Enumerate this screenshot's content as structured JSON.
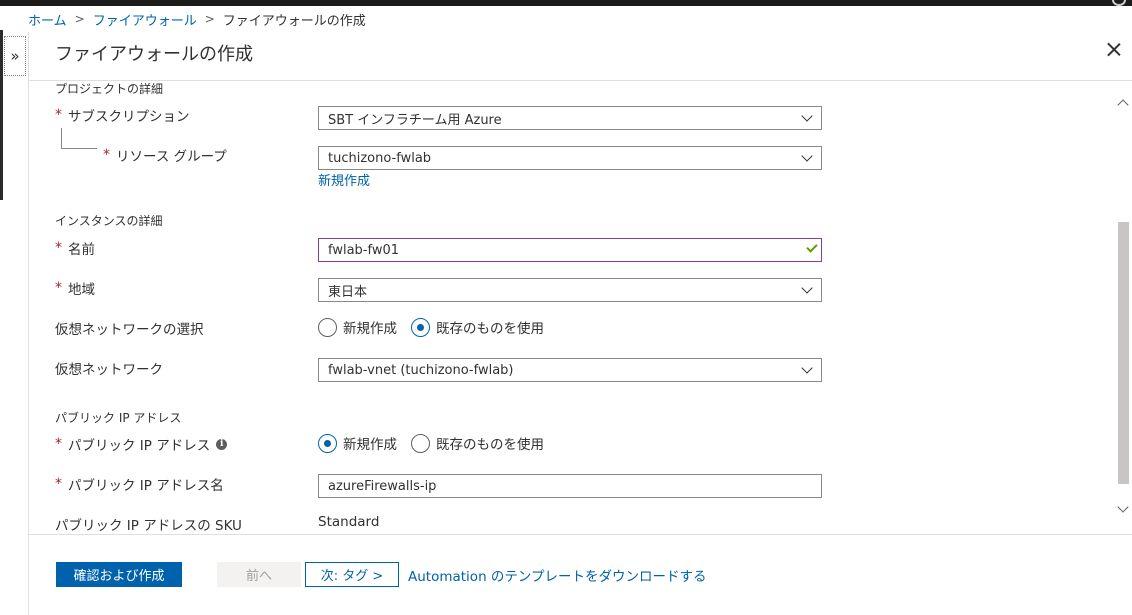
{
  "breadcrumb": {
    "items": [
      "ホーム",
      "ファイアウォール"
    ],
    "current": "ファイアウォールの作成"
  },
  "expand_glyph": "»",
  "blade": {
    "title": "ファイアウォールの作成",
    "close_icon": "close-icon"
  },
  "form": {
    "project_section": {
      "heading": "プロジェクトの詳細",
      "subscription": {
        "label": "サブスクリプション",
        "value": "SBT インフラチーム用 Azure"
      },
      "resource_group": {
        "label": "リソース グループ",
        "value": "tuchizono-fwlab",
        "create_link": "新規作成"
      }
    },
    "instance_section": {
      "heading": "インスタンスの詳細",
      "name": {
        "label": "名前",
        "value": "fwlab-fw01"
      },
      "region": {
        "label": "地域",
        "value": "東日本"
      },
      "vnet_choice": {
        "label": "仮想ネットワークの選択",
        "options": [
          "新規作成",
          "既存のものを使用"
        ],
        "selected": "既存のものを使用"
      },
      "vnet": {
        "label": "仮想ネットワーク",
        "value": "fwlab-vnet (tuchizono-fwlab)"
      }
    },
    "public_ip_section": {
      "heading": "パブリック IP アドレス",
      "public_ip": {
        "label": "パブリック IP アドレス",
        "options": [
          "新規作成",
          "既存のものを使用"
        ],
        "selected": "新規作成"
      },
      "public_ip_name": {
        "label": "パブリック IP アドレス名",
        "value": "azureFirewalls-ip"
      },
      "sku": {
        "label": "パブリック IP アドレスの SKU",
        "value": "Standard"
      }
    },
    "required_marker": "*"
  },
  "footer": {
    "review_create": "確認および作成",
    "previous": "前へ",
    "next": "次: タグ >",
    "download_template": "Automation のテンプレートをダウンロードする"
  },
  "colors": {
    "accent": "#0062ad",
    "required": "#a4262c",
    "valid_check": "#57a300",
    "valid_border": "#8a3b95"
  }
}
